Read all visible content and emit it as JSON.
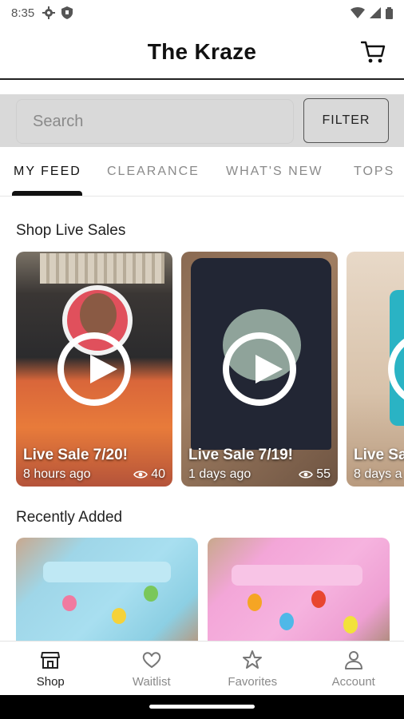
{
  "status_bar": {
    "time": "8:35"
  },
  "header": {
    "title": "The Kraze"
  },
  "search": {
    "placeholder": "Search",
    "filter_label": "FILTER"
  },
  "tabs": [
    {
      "label": "MY FEED",
      "active": true
    },
    {
      "label": "CLEARANCE",
      "active": false
    },
    {
      "label": "WHAT'S NEW",
      "active": false
    },
    {
      "label": "TOPS",
      "active": false
    }
  ],
  "live_sales": {
    "title": "Shop Live Sales",
    "items": [
      {
        "title": "Live Sale 7/20!",
        "time": "8 hours ago",
        "views": "40"
      },
      {
        "title": "Live Sale 7/19!",
        "time": "1 days ago",
        "views": "55"
      },
      {
        "title": "Live Sa",
        "time": "8 days a",
        "views": ""
      }
    ]
  },
  "recently_added": {
    "title": "Recently Added"
  },
  "bottom_nav": [
    {
      "label": "Shop",
      "icon": "shop-icon",
      "active": true
    },
    {
      "label": "Waitlist",
      "icon": "heart-icon",
      "active": false
    },
    {
      "label": "Favorites",
      "icon": "star-icon",
      "active": false
    },
    {
      "label": "Account",
      "icon": "person-icon",
      "active": false
    }
  ]
}
